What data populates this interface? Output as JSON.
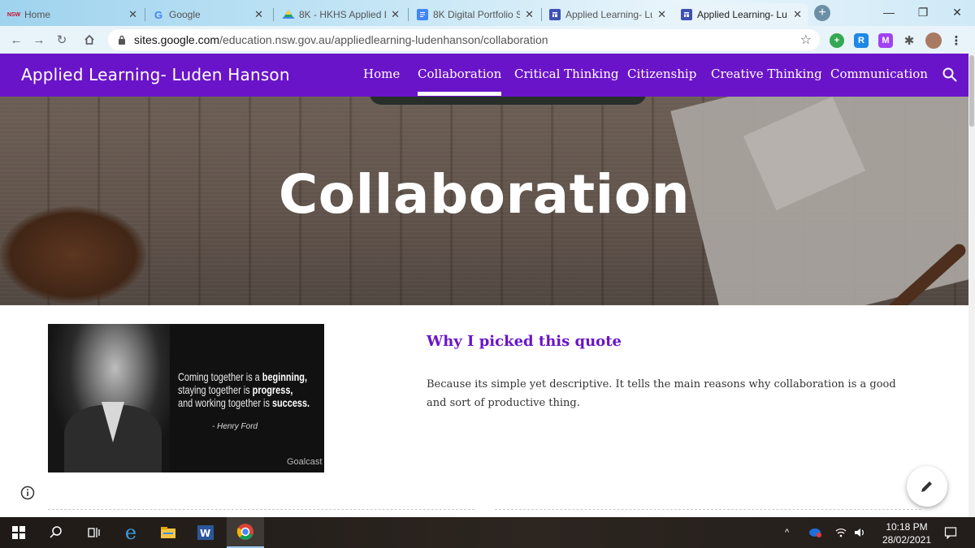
{
  "browser": {
    "tabs": [
      {
        "title": "Home",
        "favicon": "NSW",
        "active": false
      },
      {
        "title": "Google",
        "favicon": "G",
        "active": false
      },
      {
        "title": "8K - HKHS Applied L",
        "favicon": "drive",
        "active": false
      },
      {
        "title": "8K Digital Portfolio S",
        "favicon": "docs",
        "active": false
      },
      {
        "title": "Applied Learning- Lu",
        "favicon": "sites",
        "active": false
      },
      {
        "title": "Applied Learning- Lu",
        "favicon": "sites",
        "active": true
      }
    ],
    "url_domain": "sites.google.com",
    "url_path": "/education.nsw.gov.au/appliedlearning-ludenhanson/collaboration"
  },
  "site": {
    "title": "Applied Learning- Luden Hanson",
    "nav": [
      {
        "label": "Home",
        "active": false
      },
      {
        "label": "Collaboration",
        "active": true
      },
      {
        "label": "Critical Thinking",
        "active": false
      },
      {
        "label": "Citizenship",
        "active": false
      },
      {
        "label": "Creative Thinking",
        "active": false
      },
      {
        "label": "Communication",
        "active": false
      }
    ],
    "accent_color": "#6a14c9"
  },
  "banner": {
    "title": "Collaboration"
  },
  "content": {
    "quote_image": {
      "line1_plain": "Coming together is a ",
      "line1_bold": "beginning,",
      "line2_plain": "staying together is ",
      "line2_bold": "progress,",
      "line3_plain": "and working together is ",
      "line3_bold": "success.",
      "author": "- Henry Ford",
      "brand": "Goalcast"
    },
    "heading": "Why I picked this quote",
    "paragraph": "Because its simple yet descriptive. It tells the main reasons why collaboration is a good and sort of productive thing."
  },
  "taskbar": {
    "time": "10:18 PM",
    "date": "28/02/2021"
  }
}
